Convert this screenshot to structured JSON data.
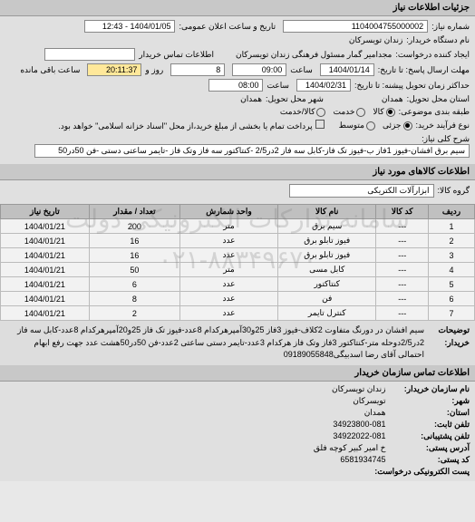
{
  "watermark_line1": "سامانه تدارکات الکترونیکی دولت",
  "watermark_line2": "۰۲۱-۸۸۳۴۹۶۷۰",
  "sections": {
    "need_info": "جزئیات اطلاعات نیاز",
    "goods_info": "اطلاعات کالاهای مورد نیاز",
    "buyer_contact": "اطلاعات تماس سازمان خریدار"
  },
  "labels": {
    "need_number": "شماره نیاز:",
    "announce_date": "تاریخ و ساعت اعلان عمومی:",
    "buyer_name": "نام دستگاه خریدار:",
    "requester": "ایجاد کننده درخواست:",
    "buyer_contact_info": "اطلاعات تماس خریدار",
    "response_deadline": "مهلت ارسال پاسخ: تا تاریخ:",
    "time": "ساعت",
    "day_and": "روز و",
    "time_remaining": "ساعت باقی مانده",
    "delivery_deadline": "حداکثر زمان تحویل پیشنه: تا تاریخ:",
    "delivery_state": "استان محل تحویل:",
    "delivery_city": "شهر محل تحویل:",
    "packaging": "طبقه بندی موضوعی:",
    "buy_process": "نوع فرآیند خرید:",
    "need_desc": "شرح کلی نیاز:",
    "goods_group": "گروه کالا:",
    "desc": "توضیحات خریدار:",
    "org_name": "نام سازمان خریدار:",
    "city": "شهر:",
    "state": "استان:",
    "phone": "تلفن ثابت:",
    "phone_backup": "تلفن پشتیبانی:",
    "postal_address": "آدرس پستی:",
    "postal_code": "کد پستی:",
    "email": "پست الکترونیکی درخواست:"
  },
  "radios": {
    "goods": "● کالا",
    "service": "○ خدمت",
    "both": "○ کالا/خدمت",
    "partial": "جزئی",
    "full_payment": "پرداخت تمام یا بخشی از مبلغ خرید،از محل \"اسناد خزانه اسلامی\" خواهد بود.",
    "medium": "متوسط"
  },
  "values": {
    "need_number": "1104004755000002",
    "announce_date": "1404/01/05 - 12:43",
    "buyer_name": "زندان تویسرکان",
    "requester": "مجدامیر گمار مسئول فرهنگی زندان تویسرکان",
    "response_date": "1404/01/14",
    "response_time": "09:00",
    "days_left": "8",
    "hours_left": "20:11:37",
    "delivery_date": "1404/02/31",
    "delivery_time": "08:00",
    "delivery_state": "همدان",
    "delivery_city": "همدان",
    "need_desc": "سیم برق افشان-فیوز 1فاز ب-فیوز تک فاز-کابل سه فاز 2در2/5 -کنتاکتور سه فاز وتک فاز -تایمر ساعتی دستی -فن 50در50",
    "goods_group": "ابزارآلات الکتریکی",
    "description": "سیم افشان در دورنگ متفاوت 2کلاف-فیوز 3فاز 25و30آمپرهرکدام 8عدد-فیوز تک فاز 25و20آمپرهرکدام 8عدد-کابل سه فاز 2در2/5دوحله متر-کنتاکتور 3فاز وتک فاز هرکدام 3عدد-تایمر دستی ساعتی 2عدد-فن 50در50هشت عدد جهت رفع ابهام احتمالی آقای رضا اسدبیگی09189055848"
  },
  "table": {
    "headers": [
      "ردیف",
      "کد کالا",
      "نام کالا",
      "واحد شمارش",
      "تعداد / مقدار",
      "تاریخ نیاز"
    ],
    "rows": [
      [
        "1",
        "---",
        "سیم برق",
        "متر",
        "200",
        "1404/01/21"
      ],
      [
        "2",
        "---",
        "فیوز تابلو برق",
        "عدد",
        "16",
        "1404/01/21"
      ],
      [
        "3",
        "---",
        "فیوز تابلو برق",
        "عدد",
        "16",
        "1404/01/21"
      ],
      [
        "4",
        "---",
        "کابل مسی",
        "متر",
        "50",
        "1404/01/21"
      ],
      [
        "5",
        "---",
        "کنتاکتور",
        "عدد",
        "6",
        "1404/01/21"
      ],
      [
        "6",
        "---",
        "فن",
        "عدد",
        "8",
        "1404/01/21"
      ],
      [
        "7",
        "---",
        "کنترل تایمر",
        "عدد",
        "2",
        "1404/01/21"
      ]
    ]
  },
  "contact": {
    "org_name": "زندان تویسرکان",
    "city": "تویسرکان",
    "state": "همدان",
    "phone": "34923800-081",
    "phone_backup": "34922022-081",
    "postal_address": "خ امیر کبیر کوچه فلق",
    "postal_code": "6581934745"
  }
}
